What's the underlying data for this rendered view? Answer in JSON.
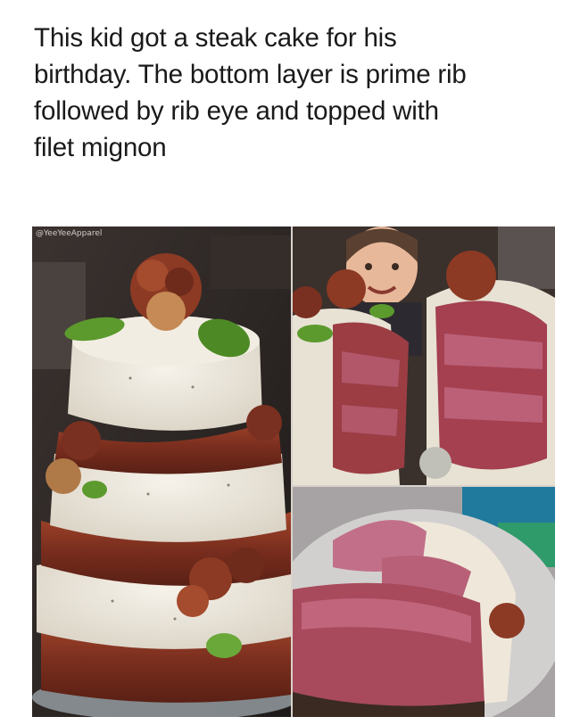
{
  "caption": {
    "line1": "This kid got a steak cake for his",
    "line2": "birthday. The bottom layer is prime rib",
    "line3": "followed by rib eye and topped with",
    "line4": "filet mignon"
  },
  "photo": {
    "watermark": "@YeeYeeApparel"
  },
  "colors": {
    "background": "#ffffff",
    "text": "#1a1a1a",
    "mashed_potato": "#ece7dc",
    "bacon": "#8b3a26",
    "steak_pink": "#b8566e",
    "basil": "#5c9a2e"
  }
}
